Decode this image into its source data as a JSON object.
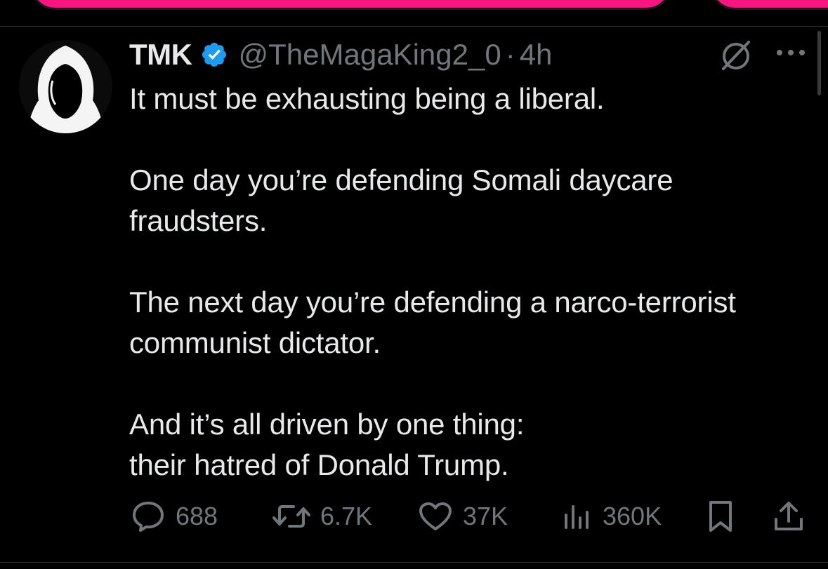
{
  "tweet": {
    "display_name": "TMK",
    "handle": "@TheMagaKing2_0",
    "separator": "·",
    "time": "4h",
    "paragraphs": [
      [
        "It must be exhausting being a liberal."
      ],
      [
        "One day you’re defending Somali daycare",
        "fraudsters."
      ],
      [
        "The next day you’re defending a narco-terrorist",
        "communist dictator."
      ],
      [
        "And it’s all driven by one thing:",
        "their hatred of Donald Trump."
      ]
    ],
    "stats": {
      "replies": "688",
      "reposts": "6.7K",
      "likes": "37K",
      "views": "360K"
    }
  },
  "colors": {
    "accent_pink": "#f7157f",
    "verified_blue": "#1d9bf0",
    "muted_text": "#71767b",
    "primary_text": "#e7e9ea",
    "background": "#000000"
  },
  "icons": {
    "verified": "verified-badge-icon",
    "grok": "grok-icon",
    "more": "more-icon",
    "reply": "reply-icon",
    "repost": "repost-icon",
    "like": "heart-icon",
    "views": "views-icon",
    "bookmark": "bookmark-icon",
    "share": "share-icon"
  }
}
